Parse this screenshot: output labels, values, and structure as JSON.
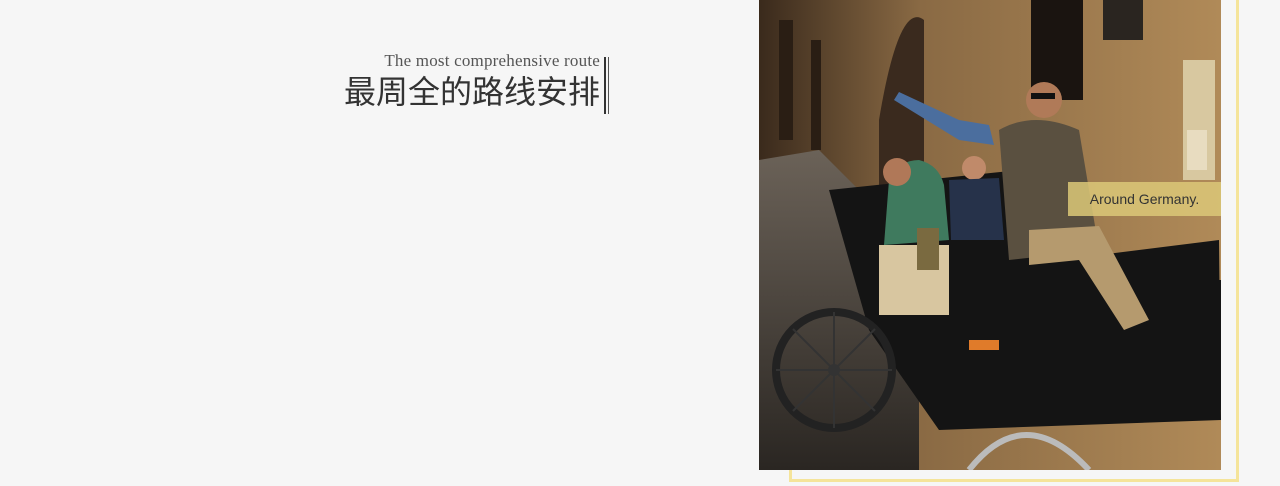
{
  "header": {
    "subtitle": "The most comprehensive route",
    "title": "最周全的路线安排"
  },
  "photo": {
    "caption": "Around Germany."
  },
  "colors": {
    "background": "#f6f6f6",
    "frame": "#f5e49a",
    "caption_bg": "#dcc878"
  }
}
